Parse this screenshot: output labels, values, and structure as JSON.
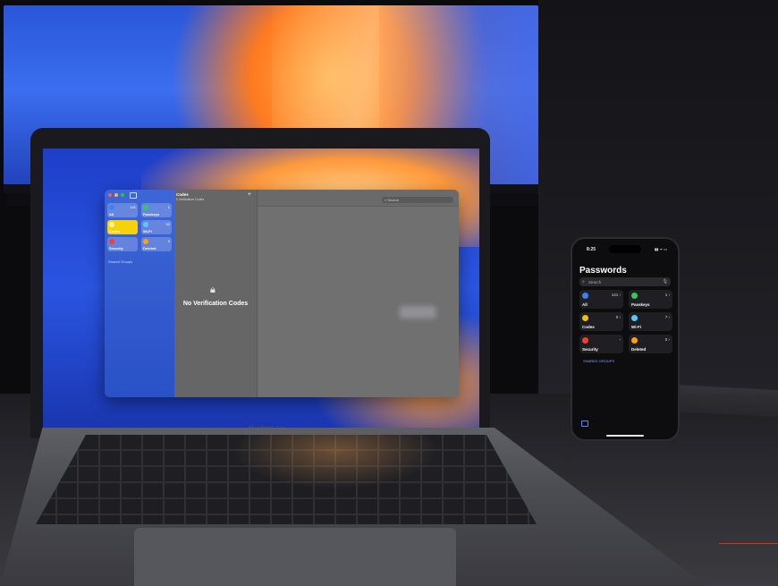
{
  "laptop": {
    "brand": "MacBook Air",
    "window": {
      "sidebar": {
        "tiles": [
          {
            "label": "All",
            "count": "141",
            "color": "#3b82f6"
          },
          {
            "label": "Passkeys",
            "count": "1",
            "color": "#34c759"
          },
          {
            "label": "Codes",
            "count": "",
            "color": "#f6c000",
            "selected": true
          },
          {
            "label": "Wi-Fi",
            "count": "33",
            "color": "#5ac8fa"
          },
          {
            "label": "Security",
            "count": "",
            "color": "#ff3b30"
          },
          {
            "label": "Deleted",
            "count": "0",
            "color": "#ff9f0a"
          }
        ],
        "shared_groups": "Shared Groups"
      },
      "list": {
        "title": "Codes",
        "subtitle": "0 Verification Codes",
        "add": "+",
        "empty_title": "No Verification Codes"
      },
      "search_placeholder": "Search"
    }
  },
  "phone": {
    "time": "8:25",
    "status": "▮▮ ᯤ ▭",
    "title": "Passwords",
    "search_placeholder": "Search",
    "tiles": [
      {
        "label": "All",
        "count": "141 ›",
        "color": "#3b82f6"
      },
      {
        "label": "Passkeys",
        "count": "1 ›",
        "color": "#34c759"
      },
      {
        "label": "Codes",
        "count": "0 ›",
        "color": "#f6c000"
      },
      {
        "label": "Wi-Fi",
        "count": "7 ›",
        "color": "#5ac8fa"
      },
      {
        "label": "Security",
        "count": "›",
        "color": "#ff3b30"
      },
      {
        "label": "Deleted",
        "count": "0 ›",
        "color": "#ff9f0a"
      }
    ],
    "shared_groups": "SHARED GROUPS"
  }
}
